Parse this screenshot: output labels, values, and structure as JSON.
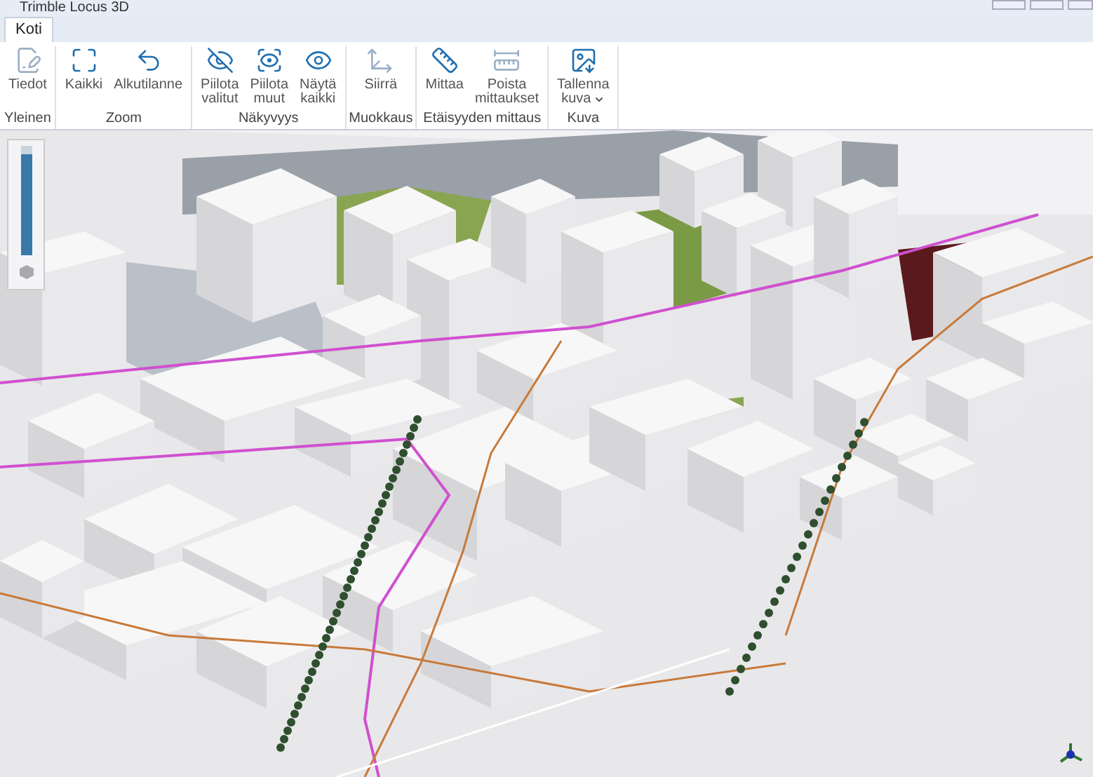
{
  "window": {
    "title": "Trimble Locus 3D"
  },
  "tabs": [
    {
      "label": "Koti",
      "selected": true
    }
  ],
  "ribbon_groups": [
    {
      "label": "Yleinen",
      "buttons": [
        {
          "lines": [
            "Tiedot"
          ],
          "disabled": true
        }
      ]
    },
    {
      "label": "Zoom",
      "buttons": [
        {
          "lines": [
            "Kaikki"
          ],
          "disabled": false
        },
        {
          "lines": [
            "Alkutilanne"
          ],
          "disabled": false
        }
      ]
    },
    {
      "label": "Näkyvyys",
      "buttons": [
        {
          "lines": [
            "Piilota",
            "valitut"
          ],
          "disabled": false
        },
        {
          "lines": [
            "Piilota",
            "muut"
          ],
          "disabled": false
        },
        {
          "lines": [
            "Näytä",
            "kaikki"
          ],
          "disabled": false
        }
      ]
    },
    {
      "label": "Muokkaus",
      "buttons": [
        {
          "lines": [
            "Siirrä"
          ],
          "disabled": true
        }
      ]
    },
    {
      "label": "Etäisyyden mittaus",
      "buttons": [
        {
          "lines": [
            "Mittaa"
          ],
          "disabled": false
        },
        {
          "lines": [
            "Poista",
            "mittaukset"
          ],
          "disabled": true
        }
      ]
    },
    {
      "label": "Kuva",
      "buttons": [
        {
          "lines": [
            "Tallenna",
            "kuva"
          ],
          "disabled": false,
          "has_menu": true
        }
      ]
    }
  ],
  "zoom_slider": {
    "level": 0.92
  }
}
